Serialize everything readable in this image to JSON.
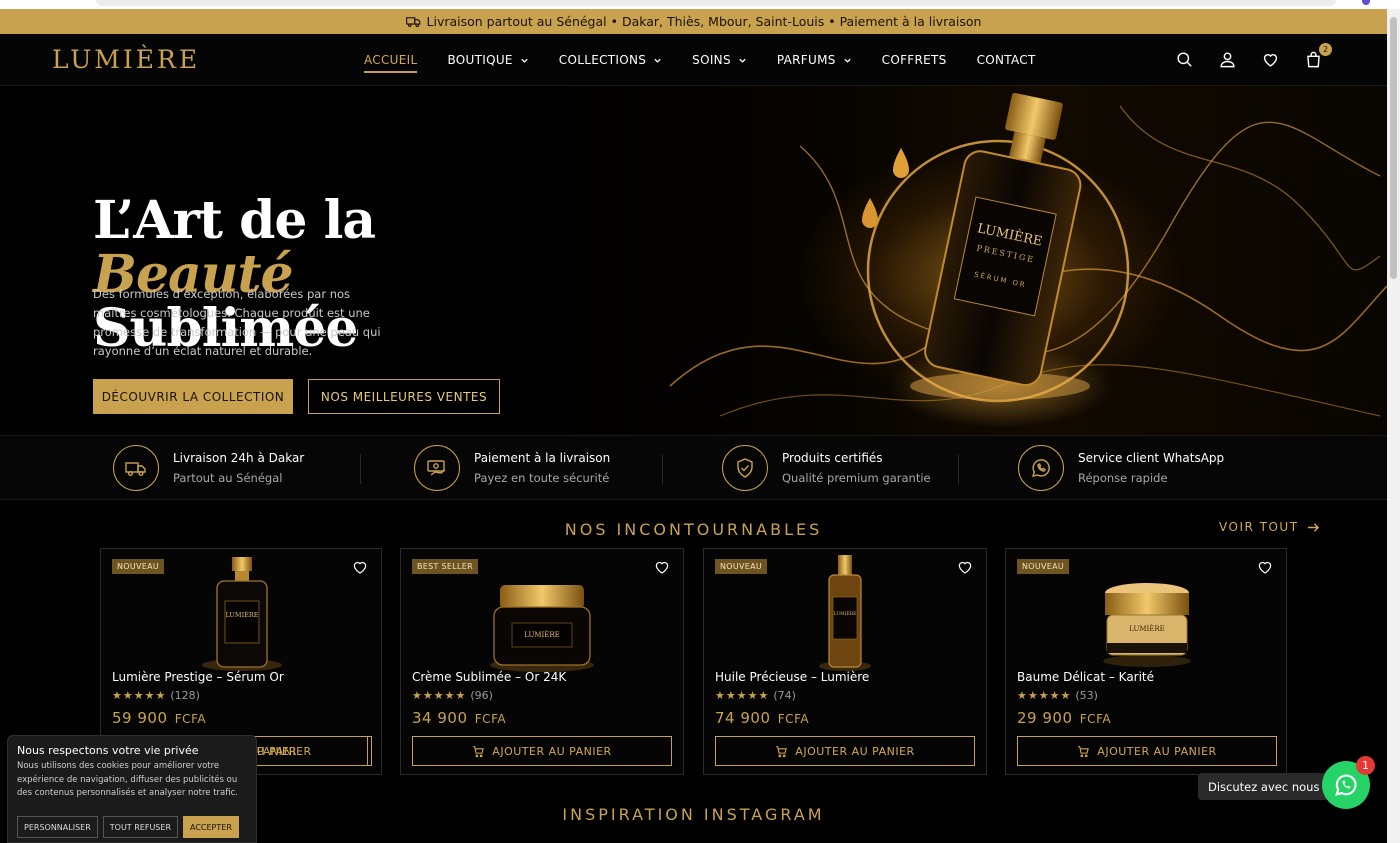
{
  "promo": {
    "text": "Livraison partout au Sénégal  •  Dakar, Thiès, Mbour, Saint-Louis  •  Paiement à la livraison",
    "icon": "truck-icon"
  },
  "brand": {
    "logo": "LUMIÈRE",
    "accent_color": "#c9a24f"
  },
  "nav": {
    "items": [
      {
        "label": "ACCUEIL",
        "active": true,
        "dropdown": false
      },
      {
        "label": "BOUTIQUE",
        "dropdown": true
      },
      {
        "label": "COLLECTIONS",
        "dropdown": true
      },
      {
        "label": "SOINS",
        "dropdown": true
      },
      {
        "label": "PARFUMS",
        "dropdown": true
      },
      {
        "label": "COFFRETS",
        "dropdown": false
      },
      {
        "label": "CONTACT",
        "dropdown": false
      }
    ],
    "icons": [
      "search-icon",
      "user-icon",
      "heart-icon",
      "bag-icon"
    ],
    "cart_count": "2"
  },
  "hero": {
    "title_line1": "L’Art de la",
    "title_line2": "Beauté",
    "title_line3": "Sublimée",
    "description": "Des formules d’exception, élaborées par nos maîtres cosmétologues. Chaque produit est une promesse de transformation — pour une peau qui rayonne d’un éclat naturel et durable.",
    "primary_button": "DÉCOUVRIR LA COLLECTION",
    "secondary_button": "NOS MEILLEURES VENTES",
    "bottle_label_1": "LUMIÈRE",
    "bottle_label_2": "PRESTIGE",
    "bottle_label_3": "SÉRUM OR"
  },
  "features": [
    {
      "title": "Livraison 24h à Dakar",
      "subtitle": "Partout au Sénégal",
      "icon": "delivery-truck-icon"
    },
    {
      "title": "Paiement à la livraison",
      "subtitle": "Payez en toute sécurité",
      "icon": "cash-payment-icon"
    },
    {
      "title": "Produits certifiés",
      "subtitle": "Qualité premium garantie",
      "icon": "shield-check-icon"
    },
    {
      "title": "Service client WhatsApp",
      "subtitle": "Réponse rapide",
      "icon": "whatsapp-icon"
    }
  ],
  "products_section": {
    "title": "NOS INCONTOURNABLES",
    "see_all": "VOIR TOUT"
  },
  "products": [
    {
      "badge": "NOUVEAU",
      "name": "Lumière Prestige – Sérum Or",
      "stars": "★★★★★",
      "reviews": "(128)",
      "price": "59 900",
      "currency": "FCFA",
      "button": "AJOUTER AU PANIER",
      "label": "LUMIÈRE"
    },
    {
      "badge": "BEST SELLER",
      "name": "Crème Sublimée – Or 24K",
      "stars": "★★★★★",
      "reviews": "(96)",
      "price": "34 900",
      "currency": "FCFA",
      "button": "AJOUTER AU PANIER",
      "label": "LUMIÈRE"
    },
    {
      "badge": "NOUVEAU",
      "name": "Huile Précieuse – Lumière",
      "stars": "★★★★★",
      "reviews": "(74)",
      "price": "74 900",
      "currency": "FCFA",
      "button": "AJOUTER AU PANIER",
      "label": "LUMIÈRE"
    },
    {
      "badge": "NOUVEAU",
      "name": "Baume Délicat – Karité",
      "stars": "★★★★★",
      "reviews": "(53)",
      "price": "29 900",
      "currency": "FCFA",
      "button": "AJOUTER AU PANIER",
      "label": "LUMIÈRE"
    }
  ],
  "instagram_section": {
    "title": "INSPIRATION INSTAGRAM"
  },
  "cookie": {
    "title": "Nous respectons votre vie privée",
    "text": "Nous utilisons des cookies pour améliorer votre expérience de navigation, diffuser des publicités ou des contenus personnalisés et analyser notre trafic.",
    "customize": "PERSONNALISER",
    "refuse": "TOUT REFUSER",
    "accept": "ACCEPTER",
    "partial_button": "PANIER"
  },
  "chat": {
    "label": "Discutez avec nous",
    "badge": "1"
  }
}
